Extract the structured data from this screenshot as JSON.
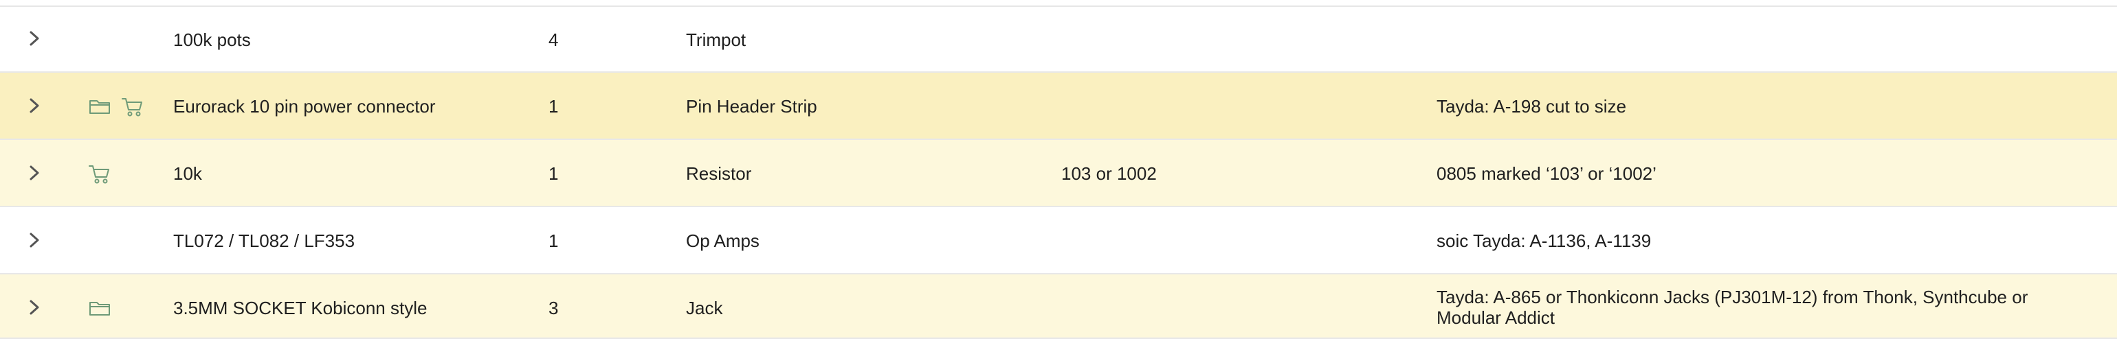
{
  "colors": {
    "row_default": "#ffffff",
    "row_highlight_strong": "#faf0c0",
    "row_highlight_light": "#fdf8dc",
    "border": "#e8e8e8",
    "icon_green": "#6e9a78",
    "chevron": "#555555"
  },
  "rows": [
    {
      "name": "100k pots",
      "quantity": "4",
      "category": "Trimpot",
      "value": "",
      "notes": "",
      "icons": [],
      "highlight": "none"
    },
    {
      "name": "Eurorack 10 pin power connector",
      "quantity": "1",
      "category": "Pin Header Strip",
      "value": "",
      "notes": "Tayda: A-198 cut to size",
      "icons": [
        "folder-icon",
        "cart-icon"
      ],
      "highlight": "strong"
    },
    {
      "name": "10k",
      "quantity": "1",
      "category": "Resistor",
      "value": "103 or 1002",
      "notes": "0805 marked ‘103’ or ‘1002’",
      "icons": [
        "cart-icon"
      ],
      "highlight": "light"
    },
    {
      "name": "TL072 / TL082 / LF353",
      "quantity": "1",
      "category": "Op Amps",
      "value": "",
      "notes": "soic Tayda: A-1136, A-1139",
      "icons": [],
      "highlight": "none"
    },
    {
      "name": "3.5MM SOCKET Kobiconn style",
      "quantity": "3",
      "category": "Jack",
      "value": "",
      "notes": "Tayda: A-865 or Thonkiconn Jacks (PJ301M-12) from Thonk, Synthcube or Modular Addict",
      "icons": [
        "folder-icon"
      ],
      "highlight": "light"
    }
  ]
}
